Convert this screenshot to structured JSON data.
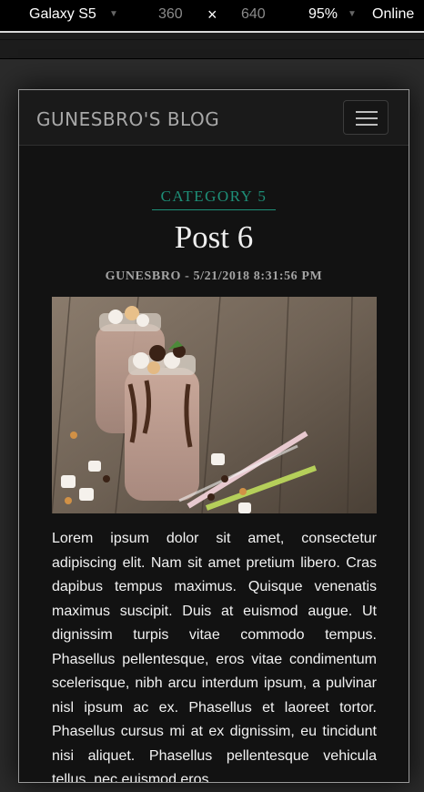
{
  "devtools": {
    "device": "Galaxy S5",
    "width": "360",
    "times": "×",
    "height": "640",
    "zoom": "95%",
    "network": "Online"
  },
  "site": {
    "brand": "GUNESBRO'S BLOG"
  },
  "post": {
    "category": "CATEGORY 5",
    "title": "Post 6",
    "meta": "GUNESBRO - 5/21/2018 8:31:56 PM",
    "body": "Lorem ipsum dolor sit amet, consectetur adipiscing elit. Nam sit amet pretium libero. Cras dapibus tempus maximus. Quisque venenatis maximus suscipit. Duis at euismod augue. Ut dignissim turpis vitae commodo tempus. Phasellus pellentesque, eros vitae condimentum scelerisque, nibh arcu interdum ipsum, a pulvinar nisl ipsum ac ex. Phasellus et laoreet tortor. Phasellus cursus mi at ex dignissim, eu tincidunt nisi aliquet. Phasellus pellentesque vehicula tellus, nec euismod eros"
  },
  "colors": {
    "accent": "#1e8f78",
    "background": "#121212",
    "text": "#f2f2f2"
  }
}
